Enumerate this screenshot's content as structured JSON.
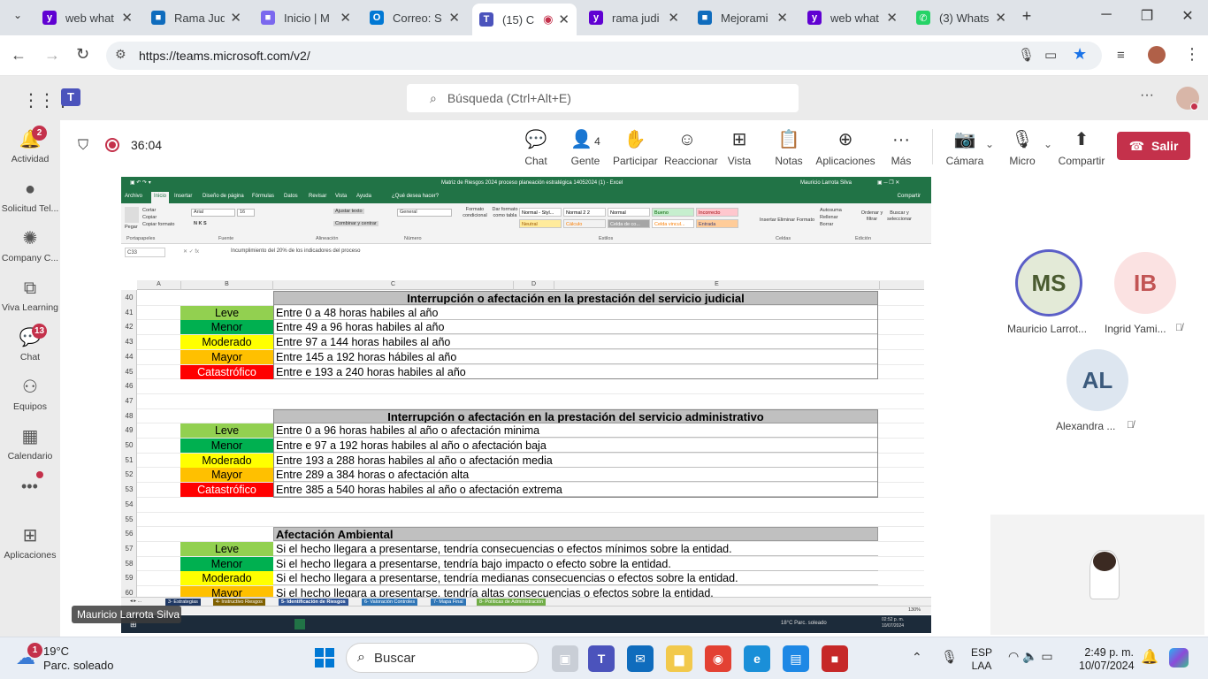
{
  "browser": {
    "tabs": [
      {
        "title": "web what",
        "icon": "yahoo-icon",
        "color": "#6001d2",
        "active": false
      },
      {
        "title": "Rama Jud",
        "icon": "sharepoint-icon",
        "color": "#0f6cbd",
        "active": false
      },
      {
        "title": "Inicio | M",
        "icon": "office-icon",
        "color": "#7b68ee",
        "active": false
      },
      {
        "title": "Correo: S",
        "icon": "outlook-icon",
        "color": "#0078d4",
        "active": false
      },
      {
        "title": "(15) C",
        "icon": "teams-icon",
        "color": "#4b53bc",
        "active": true
      },
      {
        "title": "rama judi",
        "icon": "yahoo-icon",
        "color": "#6001d2",
        "active": false
      },
      {
        "title": "Mejorami",
        "icon": "sharepoint-icon",
        "color": "#0f6cbd",
        "active": false
      },
      {
        "title": "web what",
        "icon": "yahoo-icon",
        "color": "#6001d2",
        "active": false
      },
      {
        "title": "(3) Whats",
        "icon": "whatsapp-icon",
        "color": "#25d366",
        "active": false
      }
    ],
    "url": "https://teams.microsoft.com/v2/"
  },
  "teams": {
    "search_placeholder": "Búsqueda (Ctrl+Alt+E)",
    "rail": [
      {
        "label": "Actividad",
        "icon": "bell-icon",
        "badge": "2"
      },
      {
        "label": "Solicitud Tel...",
        "icon": "app-icon",
        "badge": ""
      },
      {
        "label": "Company C...",
        "icon": "company-icon",
        "badge": ""
      },
      {
        "label": "Viva Learning",
        "icon": "learning-icon",
        "badge": ""
      },
      {
        "label": "Chat",
        "icon": "chat-icon",
        "badge": "13"
      },
      {
        "label": "Equipos",
        "icon": "teams-group-icon",
        "badge": ""
      },
      {
        "label": "Calendario",
        "icon": "calendar-icon",
        "badge": ""
      },
      {
        "label": "Aplicaciones",
        "icon": "apps-icon",
        "badge": ""
      }
    ],
    "meeting": {
      "timer": "36:04",
      "buttons": [
        {
          "label": "Chat",
          "icon": "chat-icon"
        },
        {
          "label": "Gente",
          "icon": "people-icon",
          "count": "4"
        },
        {
          "label": "Participar",
          "icon": "hand-icon"
        },
        {
          "label": "Reaccionar",
          "icon": "smile-icon"
        },
        {
          "label": "Vista",
          "icon": "grid-icon"
        },
        {
          "label": "Notas",
          "icon": "notes-icon"
        },
        {
          "label": "Aplicaciones",
          "icon": "add-icon"
        },
        {
          "label": "Más",
          "icon": "more-icon"
        },
        {
          "label": "Cámara",
          "icon": "camera-off-icon"
        },
        {
          "label": "Micro",
          "icon": "mic-icon"
        },
        {
          "label": "Compartir",
          "icon": "share-icon"
        }
      ],
      "leave_label": "Salir"
    },
    "participants": [
      {
        "initials": "MS",
        "name": "Mauricio Larrot...",
        "bg": "#e3ead7",
        "fg": "#4a5b30"
      },
      {
        "initials": "IB",
        "name": "Ingrid Yami...",
        "bg": "#fbe2e2",
        "fg": "#c25555"
      },
      {
        "initials": "AL",
        "name": "Alexandra ...",
        "bg": "#dde6f0",
        "fg": "#3b5a7c"
      }
    ],
    "presenter": "Mauricio Larrota Silva"
  },
  "excel": {
    "title": "Matriz de Riesgos 2024 proceso planeación estratégica 14052024 (1) - Excel",
    "user": "Mauricio Larrota Silva",
    "menu": [
      "Archivo",
      "Inicio",
      "Insertar",
      "Diseño de página",
      "Fórmulas",
      "Datos",
      "Revisar",
      "Vista",
      "Ayuda",
      "¿Qué desea hacer?"
    ],
    "share": "Compartir",
    "ribbon": {
      "clipboard": [
        "Cortar",
        "Copiar",
        "Copiar formato"
      ],
      "paste": "Pegar",
      "font": "Arial",
      "size": "16",
      "wrap": "Ajustar texto",
      "merge": "Combinar y centrar",
      "numfmt": "General",
      "cond_fmt": "Formato condicional",
      "table_fmt": "Dar formato como tabla",
      "styles": [
        {
          "name": "Normal - Styl...",
          "bg": "#ffffff",
          "fg": "#000"
        },
        {
          "name": "Normal 2 2",
          "bg": "#ffffff",
          "fg": "#000"
        },
        {
          "name": "Normal",
          "bg": "#ffffff",
          "fg": "#000"
        },
        {
          "name": "Bueno",
          "bg": "#c6efce",
          "fg": "#006100"
        },
        {
          "name": "Incorrecto",
          "bg": "#ffc7ce",
          "fg": "#9c0006"
        },
        {
          "name": "Neutral",
          "bg": "#ffeb9c",
          "fg": "#9c5700"
        },
        {
          "name": "Cálculo",
          "bg": "#f2f2f2",
          "fg": "#fa7d00"
        },
        {
          "name": "Celda de co...",
          "bg": "#a5a5a5",
          "fg": "#ffffff"
        },
        {
          "name": "Celda vincul...",
          "bg": "#ffffff",
          "fg": "#fa7d00"
        },
        {
          "name": "Entrada",
          "bg": "#ffcc99",
          "fg": "#3f3f76"
        }
      ],
      "cells": [
        "Insertar",
        "Eliminar",
        "Formato"
      ],
      "editing": [
        "Autosuma",
        "Rellenar",
        "Borrar",
        "Ordenar y filtrar",
        "Buscar y seleccionar"
      ],
      "groups": [
        "Portapapeles",
        "Fuente",
        "Alineación",
        "Número",
        "Estilos",
        "Celdas",
        "Edición"
      ]
    },
    "namebox": "C33",
    "formula": "Incumplimiento del 20% de los indicadores del proceso",
    "columns": [
      "A",
      "B",
      "C",
      "D",
      "E"
    ],
    "rows": [
      "40",
      "41",
      "42",
      "43",
      "44",
      "45",
      "46",
      "47",
      "48",
      "49",
      "50",
      "51",
      "52",
      "53",
      "54",
      "55",
      "56",
      "57",
      "58",
      "59",
      "60"
    ],
    "levels": [
      {
        "name": "Leve",
        "color": "#92d050"
      },
      {
        "name": "Menor",
        "color": "#00b050"
      },
      {
        "name": "Moderado",
        "color": "#ffff00"
      },
      {
        "name": "Mayor",
        "color": "#ffc000"
      },
      {
        "name": "Catastrófico",
        "color": "#ff0000"
      }
    ],
    "blocks": [
      {
        "header": "Interrupción o afectación en la prestación del servicio judicial",
        "items": [
          "Entre  0 a 48 horas habiles al año",
          "Entre 49 a 96 horas  habiles al año",
          "Entre  97 a 144 horas   habiles al año",
          "Entre  145 a 192 horas  hábiles al año",
          "Entre e 193 a 240 horas  habiles al año"
        ]
      },
      {
        "header": "Interrupción o afectación en la prestación del servicio administrativo",
        "items": [
          "Entre 0 a 96 horas habiles al año  o afectación minima",
          "Entre e 97 a 192 horas  habiles al año o afectación baja",
          "Entre 193 a 288 horas   habiles al año  o afectación media",
          "Entre  289 a 384 horas o afectación alta",
          "Entre  385 a 540 horas  habiles al año  o afectación extrema"
        ]
      },
      {
        "header": "Afectación Ambiental",
        "items": [
          "Si el hecho llegara a presentarse, tendría consecuencias o efectos mínimos sobre la entidad.",
          "Si el hecho llegara a presentarse, tendría bajo impacto o efecto sobre la entidad.",
          "Si el hecho llegara a presentarse, tendría medianas consecuencias o efectos sobre la entidad.",
          "Si el hecho llegara a presentarse, tendría altas consecuencias o efectos sobre la entidad."
        ]
      }
    ],
    "sheet_tabs": [
      {
        "name": "3- Estrategias",
        "bg": "#1f3864"
      },
      {
        "name": "4- Instructivo Riesgos",
        "bg": "#7f6000"
      },
      {
        "name": "5- Identificación de Riesgos",
        "bg": "#2f5597"
      },
      {
        "name": "6- Valoración Controles",
        "bg": "#2e75b6"
      },
      {
        "name": "7- Mapa Final",
        "bg": "#2e75b6"
      },
      {
        "name": "8- Políticas de Administración",
        "bg": "#70ad47"
      }
    ],
    "zoom": "130%",
    "inner_taskbar": {
      "weather": "18°C  Parc. soleado",
      "time": "02:52 p. m.",
      "date": "10/07/2024"
    }
  },
  "windows": {
    "weather_temp": "19°C",
    "weather_desc": "Parc. soleado",
    "weather_badge": "1",
    "search": "Buscar",
    "lang1": "ESP",
    "lang2": "LAA",
    "time": "2:49 p. m.",
    "date": "10/07/2024"
  }
}
